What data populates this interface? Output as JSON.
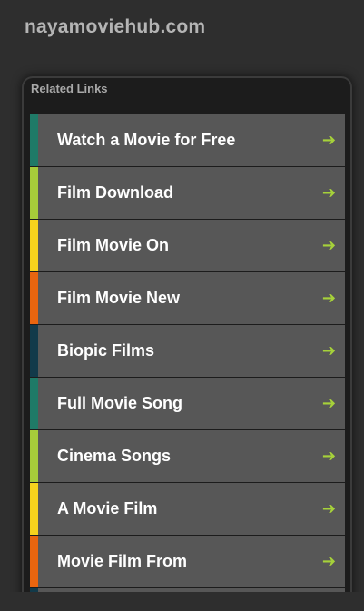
{
  "site": {
    "title": "nayamoviehub.com"
  },
  "panel": {
    "header": "Related Links",
    "arrow_glyph": "➔",
    "arrow_color": "#a6d13a",
    "links": [
      {
        "label": "Watch a Movie for Free",
        "accent": "#1f7a67"
      },
      {
        "label": "Film Download",
        "accent": "#a6cc3a"
      },
      {
        "label": "Film Movie On",
        "accent": "#f5d21d"
      },
      {
        "label": "Film Movie New",
        "accent": "#e8650f"
      },
      {
        "label": "Biopic Films",
        "accent": "#123a4a"
      },
      {
        "label": "Full Movie Song",
        "accent": "#1f7a67"
      },
      {
        "label": "Cinema Songs",
        "accent": "#a6cc3a"
      },
      {
        "label": "A Movie Film",
        "accent": "#f5d21d"
      },
      {
        "label": "Movie Film From",
        "accent": "#e8650f"
      },
      {
        "label": "",
        "accent": "#123a4a"
      }
    ]
  }
}
